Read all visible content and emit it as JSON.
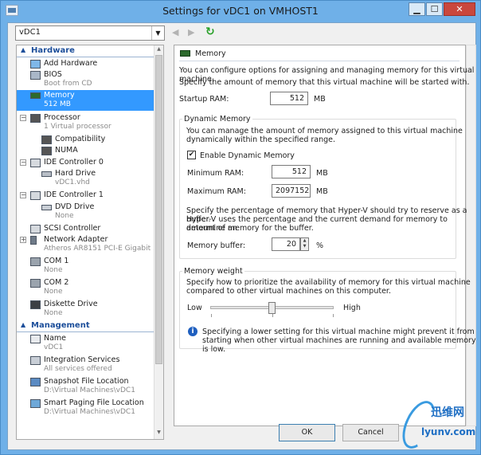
{
  "window": {
    "title": "Settings for vDC1 on VMHOST1",
    "min": "▁",
    "max": "☐",
    "close": "✕"
  },
  "toolbar": {
    "vm_selector": "vDC1",
    "back": "◀",
    "forward": "▶",
    "refresh": "↻"
  },
  "tree": {
    "hardware_header": "Hardware",
    "management_header": "Management",
    "items": [
      {
        "label": "Add Hardware",
        "sub": ""
      },
      {
        "label": "BIOS",
        "sub": "Boot from CD"
      },
      {
        "label": "Memory",
        "sub": "512 MB"
      },
      {
        "label": "Processor",
        "sub": "1 Virtual processor"
      },
      {
        "label": "Compatibility",
        "sub": ""
      },
      {
        "label": "NUMA",
        "sub": ""
      },
      {
        "label": "IDE Controller 0",
        "sub": ""
      },
      {
        "label": "Hard Drive",
        "sub": "vDC1.vhd"
      },
      {
        "label": "IDE Controller 1",
        "sub": ""
      },
      {
        "label": "DVD Drive",
        "sub": "None"
      },
      {
        "label": "SCSI Controller",
        "sub": ""
      },
      {
        "label": "Network Adapter",
        "sub": "Atheros AR8151 PCI-E Gigabit ..."
      },
      {
        "label": "COM 1",
        "sub": "None"
      },
      {
        "label": "COM 2",
        "sub": "None"
      },
      {
        "label": "Diskette Drive",
        "sub": "None"
      }
    ],
    "mgmt_items": [
      {
        "label": "Name",
        "sub": "vDC1"
      },
      {
        "label": "Integration Services",
        "sub": "All services offered"
      },
      {
        "label": "Snapshot File Location",
        "sub": "D:\\Virtual Machines\\vDC1"
      },
      {
        "label": "Smart Paging File Location",
        "sub": "D:\\Virtual Machines\\vDC1"
      }
    ]
  },
  "memory": {
    "header": "Memory",
    "intro1": "You can configure options for assigning and managing memory for this virtual machine.",
    "intro2": "Specify the amount of memory that this virtual machine will be started with.",
    "startup_label": "Startup RAM:",
    "startup_value": "512",
    "unit_mb": "MB",
    "dynamic_title": "Dynamic Memory",
    "dynamic_desc1": "You can manage the amount of memory assigned to this virtual machine",
    "dynamic_desc2": "dynamically within the specified range.",
    "enable_label": "Enable Dynamic Memory",
    "enable_mark": "✔",
    "min_label": "Minimum RAM:",
    "min_value": "512",
    "max_label": "Maximum RAM:",
    "max_value": "2097152",
    "buffer_desc1": "Specify the percentage of memory that Hyper-V should try to reserve as a buffer.",
    "buffer_desc2": "Hyper-V uses the percentage and the current demand for memory to determine an",
    "buffer_desc3": "amount of memory for the buffer.",
    "buffer_label": "Memory buffer:",
    "buffer_value": "20",
    "percent": "%",
    "weight_title": "Memory weight",
    "weight_desc1": "Specify how to prioritize the availability of memory for this virtual machine",
    "weight_desc2": "compared to other virtual machines on this computer.",
    "low": "Low",
    "high": "High",
    "weight_level": 0.5,
    "info_mark": "i",
    "info1": "Specifying a lower setting for this virtual machine might prevent it from",
    "info2": "starting when other virtual machines are running and available memory is low."
  },
  "buttons": {
    "ok": "OK",
    "cancel": "Cancel"
  },
  "watermark": {
    "cn": "迅维网",
    "en": "lyunv.com"
  }
}
